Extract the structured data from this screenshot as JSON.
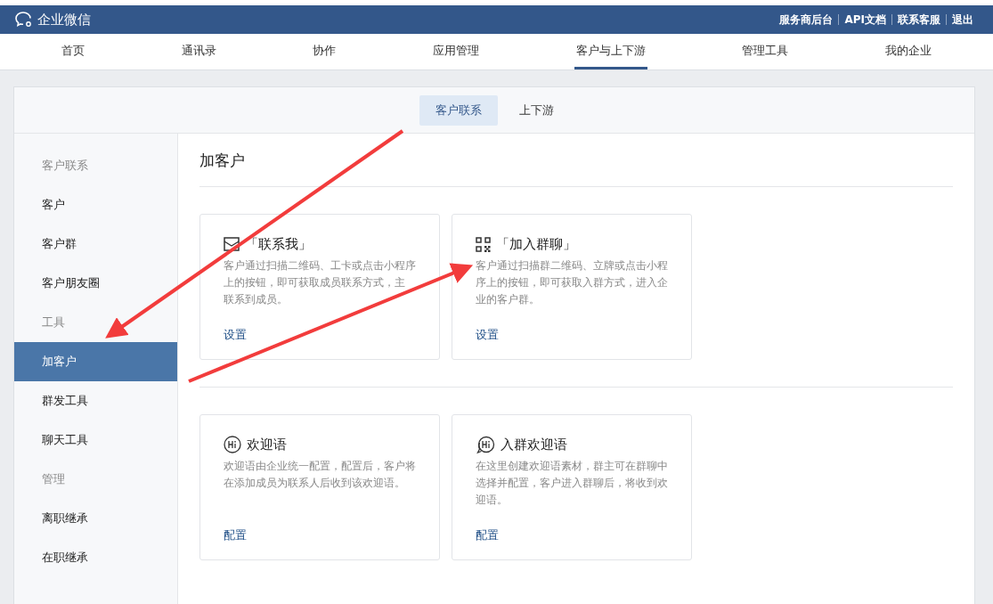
{
  "header": {
    "brand": "企业微信",
    "links": [
      "服务商后台",
      "API文档",
      "联系客服",
      "退出"
    ]
  },
  "nav": [
    {
      "label": "首页",
      "selected": false
    },
    {
      "label": "通讯录",
      "selected": false
    },
    {
      "label": "协作",
      "selected": false
    },
    {
      "label": "应用管理",
      "selected": false
    },
    {
      "label": "客户与上下游",
      "selected": true
    },
    {
      "label": "管理工具",
      "selected": false
    },
    {
      "label": "我的企业",
      "selected": false
    }
  ],
  "subtabs": [
    {
      "label": "客户联系",
      "selected": true
    },
    {
      "label": "上下游",
      "selected": false
    }
  ],
  "sidebar": [
    {
      "title": "客户联系",
      "items": [
        {
          "label": "客户",
          "selected": false
        },
        {
          "label": "客户群",
          "selected": false
        },
        {
          "label": "客户朋友圈",
          "selected": false
        }
      ]
    },
    {
      "title": "工具",
      "items": [
        {
          "label": "加客户",
          "selected": true
        },
        {
          "label": "群发工具",
          "selected": false
        },
        {
          "label": "聊天工具",
          "selected": false
        }
      ]
    },
    {
      "title": "管理",
      "items": [
        {
          "label": "离职继承",
          "selected": false
        },
        {
          "label": "在职继承",
          "selected": false
        }
      ]
    }
  ],
  "content": {
    "title": "加客户",
    "sections": [
      {
        "cards": [
          {
            "kind": "envelope",
            "title": "「联系我」",
            "description_lines": [
              "客户通过扫描二维码、工卡或点击小程序",
              "上的按钮，即可获取成员联系方式，主",
              "联系到成员。"
            ],
            "action": "设置"
          },
          {
            "kind": "qr",
            "title": "「加入群聊」",
            "description_lines": [
              "客户通过扫描群二维码、立牌或点击小程",
              "序上的按钮，即可获取入群方式，进入企",
              "业的客户群。"
            ],
            "action": "设置"
          }
        ]
      },
      {
        "cards": [
          {
            "kind": "hi",
            "title": "欢迎语",
            "description_lines": [
              "欢迎语由企业统一配置，配置后，客户将",
              "在添加成员为联系人后收到该欢迎语。"
            ],
            "action": "配置"
          },
          {
            "kind": "hi-chat",
            "title": "入群欢迎语",
            "description_lines": [
              "在这里创建欢迎语素材，群主可在群聊中",
              "选择并配置，客户进入群聊后，将收到欢",
              "迎语。"
            ],
            "action": "配置"
          }
        ]
      }
    ]
  }
}
